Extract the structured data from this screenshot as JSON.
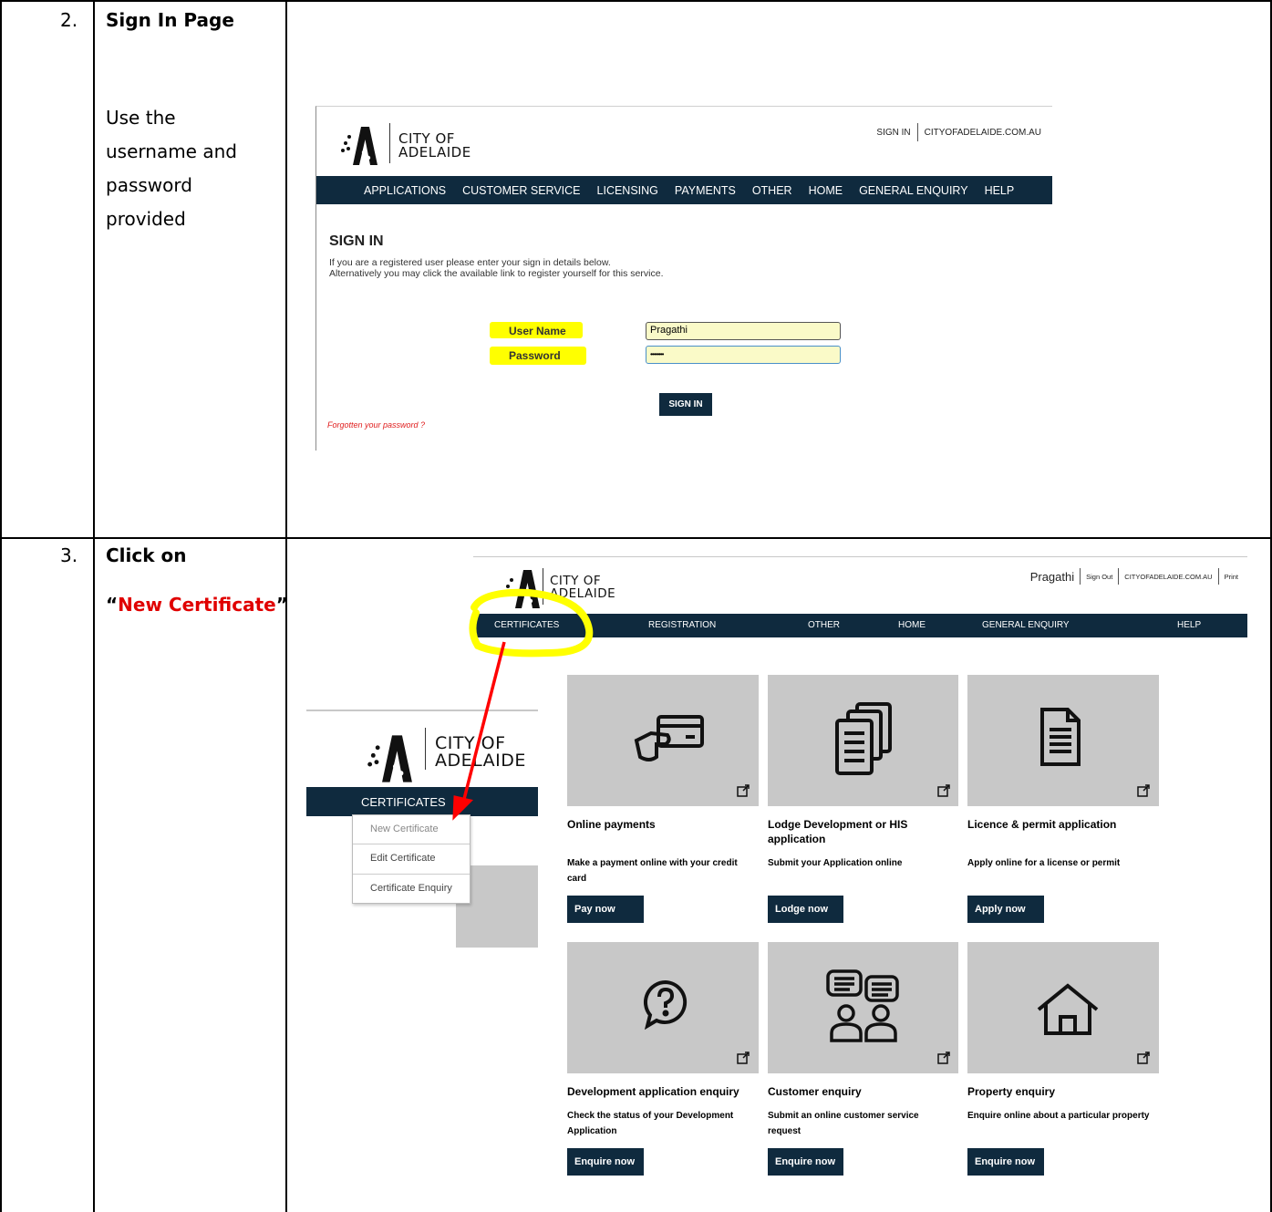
{
  "steps": [
    {
      "number": "2.",
      "title": "Sign In Page",
      "instruction_lines": [
        "Use the",
        "username and",
        "password",
        "provided"
      ]
    },
    {
      "number": "3.",
      "title": "Click on",
      "instruction_prefix": "“",
      "instruction_highlight": "New Certificate",
      "instruction_suffix": "”"
    }
  ],
  "signin_screen": {
    "logo": {
      "line1": "CITY OF",
      "line2": "ADELAIDE"
    },
    "top_links": [
      "SIGN IN",
      "CITYOFADELAIDE.COM.AU"
    ],
    "nav": [
      "APPLICATIONS",
      "CUSTOMER SERVICE",
      "LICENSING",
      "PAYMENTS",
      "OTHER",
      "HOME",
      "GENERAL ENQUIRY",
      "HELP"
    ],
    "heading": "SIGN IN",
    "intro_line1": "If you are a registered user please enter your sign in details below.",
    "intro_line2": "Alternatively you may click the available link to register yourself for this service.",
    "username_label": "User Name",
    "username_value": "Pragathi",
    "password_label": "Password",
    "password_value": "••••••••",
    "signin_button": "SIGN IN",
    "forgot_link": "Forgotten your password ?",
    "highlight_color": "#ffff00",
    "nav_color": "#0f2a3e"
  },
  "portal_screen": {
    "logo": {
      "line1": "CITY OF",
      "line2": "ADELAIDE"
    },
    "user": "Pragathi",
    "top_links": [
      "Sign Out",
      "CITYOFADELAIDE.COM.AU",
      "Print"
    ],
    "nav": [
      "CERTIFICATES",
      "REGISTRATION",
      "OTHER",
      "HOME",
      "GENERAL ENQUIRY",
      "HELP"
    ],
    "cards": [
      {
        "icon": "credit-card-icon",
        "title": "Online payments",
        "desc": "Make a payment online with your credit card",
        "button": "Pay now"
      },
      {
        "icon": "documents-stack-icon",
        "title": "Lodge Development or HIS application",
        "desc": "Submit your Application online",
        "button": "Lodge now"
      },
      {
        "icon": "document-icon",
        "title": "Licence & permit application",
        "desc": "Apply online for a license or permit",
        "button": "Apply now"
      },
      {
        "icon": "question-bubble-icon",
        "title": "Development application enquiry",
        "desc": "Check the status of your Development Application",
        "button": "Enquire now"
      },
      {
        "icon": "customer-chat-icon",
        "title": "Customer enquiry",
        "desc": "Submit an online customer service request",
        "button": "Enquire now"
      },
      {
        "icon": "house-icon",
        "title": "Property enquiry",
        "desc": "Enquire online about a particular property",
        "button": "Enquire now"
      }
    ]
  },
  "inset_screen": {
    "logo": {
      "line1": "CITY OF",
      "line2": "ADELAIDE"
    },
    "menu_title": "CERTIFICATES",
    "menu_items": [
      "New Certificate",
      "Edit Certificate",
      "Certificate Enquiry"
    ]
  },
  "annotation": {
    "arrow_color": "#ff0000",
    "circle_color": "#ffff00"
  }
}
